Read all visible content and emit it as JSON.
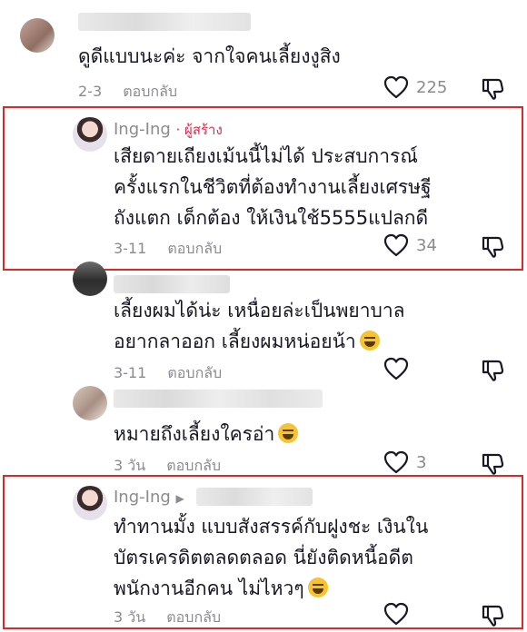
{
  "comments": [
    {
      "text_lines": [
        "ดูดีแบบนะค่ะ จากใจคนเลี้ยงงูสิง"
      ],
      "date": "2-3",
      "reply_label": "ตอบกลับ",
      "likes": "225"
    },
    {
      "username": "Ing-Ing",
      "creator_label": "· ผู้สร้าง",
      "text_lines": [
        "เสียดายเถียงเม้นนี้ไม่ได้ ประสบการณ์",
        "ครั้งแรกในชีวิตที่ต้องทำงานเลี้ยงเศรษฐี",
        "ถังแตก เด็กต้อง ให้เงินใช้5555แปลกดี"
      ],
      "date": "3-11",
      "reply_label": "ตอบกลับ",
      "likes": "34"
    },
    {
      "text_lines": [
        "เลี้ยงผมได้น่ะ เหนื่อยล่ะเป็นพยาบาล",
        "อยากลาออก เลี้ยงผมหน่อยน้า"
      ],
      "date": "3-11",
      "reply_label": "ตอบกลับ",
      "likes": ""
    },
    {
      "text_lines": [
        "หมายถึงเลี้ยงใครอ่า"
      ],
      "date": "3 วัน",
      "reply_label": "ตอบกลับ",
      "likes": "3"
    },
    {
      "username": "Ing-Ing",
      "text_lines": [
        "ทำทานมั้ง แบบสังสรรค์กับฝูงชะ เงินใน",
        "บัตรเครดิตตลดตลอด นี่ยังติดหนี้อดีต",
        "พนักงานอีกคน ไม่ไหวๆ"
      ],
      "date": "3 วัน",
      "reply_label": "ตอบกลับ",
      "likes": ""
    }
  ],
  "colors": {
    "highlight": "#d72b2b",
    "creator": "#e0294a",
    "meta": "#8a8b91",
    "text": "#161823"
  }
}
